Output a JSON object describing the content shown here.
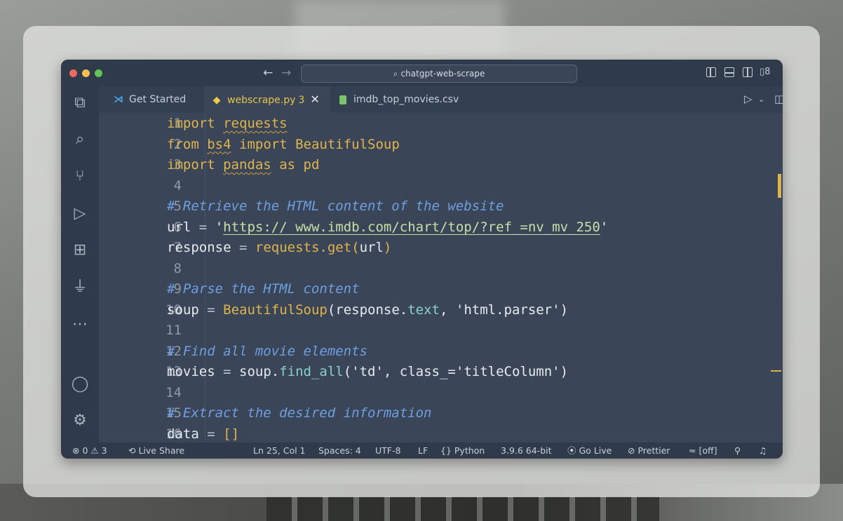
{
  "titlebar": {
    "search_text": "chatgpt-web-scrape",
    "back_glyph": "←",
    "forward_glyph": "→"
  },
  "tabs": [
    {
      "label": "Get Started",
      "icon": "vscode-icon"
    },
    {
      "label": "webscrape.py",
      "badge": "3",
      "icon": "python-icon",
      "active": true
    },
    {
      "label": "imdb_top_movies.csv",
      "icon": "csv-file-icon"
    }
  ],
  "editor": {
    "lines": [
      {
        "n": "1"
      },
      {
        "n": "2"
      },
      {
        "n": "3"
      },
      {
        "n": "4"
      },
      {
        "n": "5"
      },
      {
        "n": "6"
      },
      {
        "n": "7"
      },
      {
        "n": "8"
      },
      {
        "n": "9"
      },
      {
        "n": "10"
      },
      {
        "n": "11"
      },
      {
        "n": "12"
      },
      {
        "n": "13"
      },
      {
        "n": "14"
      },
      {
        "n": "15"
      },
      {
        "n": "16"
      }
    ],
    "tokens": {
      "l1": [
        "import",
        "requests"
      ],
      "l2": [
        "from",
        "bs4",
        "import",
        "BeautifulSoup"
      ],
      "l3": [
        "import",
        "pandas",
        "as",
        "pd"
      ],
      "l5": "# Retrieve the HTML content of the website",
      "l6": [
        "url",
        "=",
        "'",
        "https:// www.imdb.com/chart/top/?ref_=nv_mv_250",
        "'"
      ],
      "l7": [
        "response",
        "=",
        "requests",
        ".get(",
        "url",
        ")"
      ],
      "l9": "# Parse the HTML content",
      "l10": [
        "soup",
        "=",
        "BeautifulSoup",
        "(response.",
        "text",
        ", 'html.parser')"
      ],
      "l12": "# Find all movie elements",
      "l13": [
        "movies",
        "=",
        "soup.",
        "find_all",
        "('td', class_=",
        "'titleColumn'",
        ")"
      ],
      "l15": "# Extract the desired information",
      "l16": [
        "data",
        "=",
        "[]"
      ]
    }
  },
  "status": {
    "errors": "0",
    "warnings": "3",
    "live_share": "Live Share",
    "position": "Ln 25, Col 1",
    "spaces": "Spaces: 4",
    "encoding": "UTF-8",
    "eol": "LF",
    "language": "Python",
    "interpreter": "3.9.6 64-bit",
    "go_live": "Go Live",
    "prettier": "Prettier",
    "copilot": "[off]"
  },
  "colors": {
    "editor_bg": "#3a4658",
    "keyword": "#e0b44c",
    "comment": "#6f9ee0"
  }
}
